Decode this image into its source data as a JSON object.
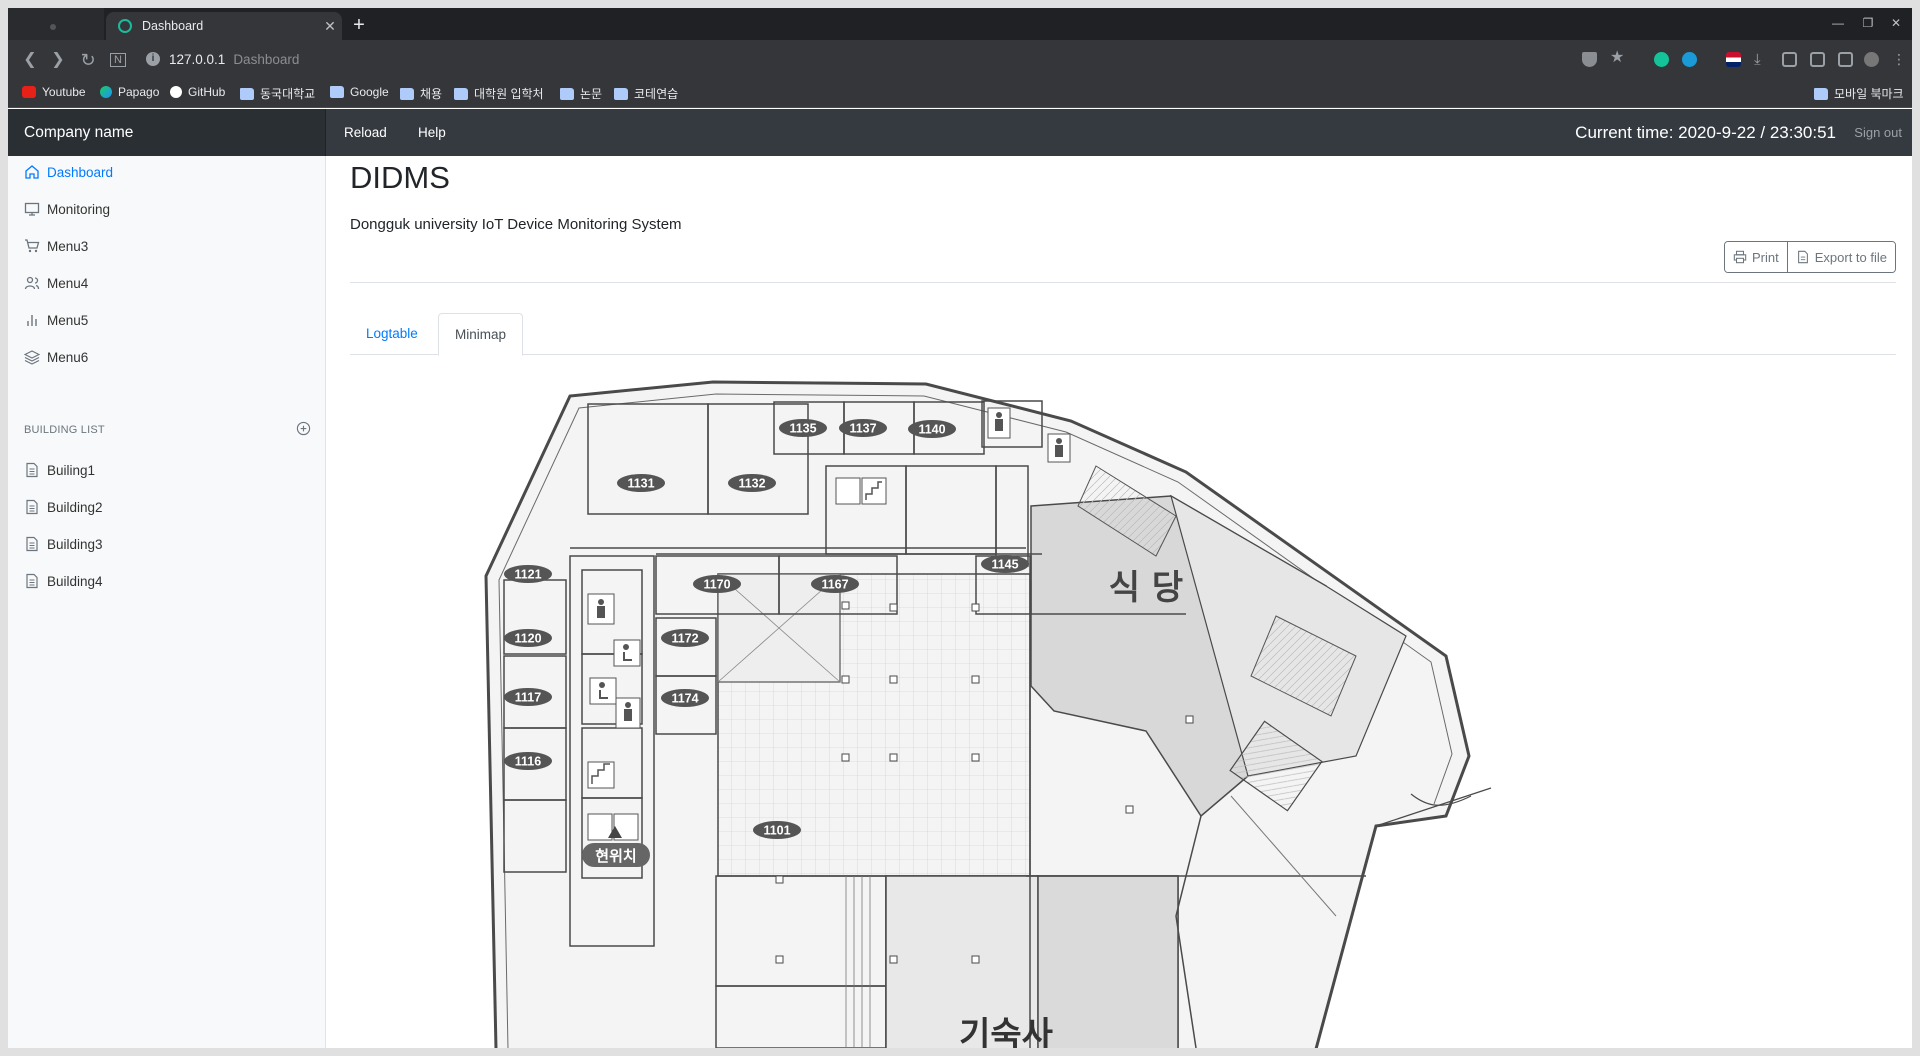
{
  "browser": {
    "tab_title": "Dashboard",
    "url_host": "127.0.0.1",
    "url_suffix": "Dashboard",
    "bookmarks": [
      {
        "label": "Youtube",
        "icon": "youtube-icon"
      },
      {
        "label": "Papago",
        "icon": "papago-icon"
      },
      {
        "label": "GitHub",
        "icon": "github-icon"
      },
      {
        "label": "동국대학교",
        "icon": "folder-icon"
      },
      {
        "label": "Google",
        "icon": "folder-icon"
      },
      {
        "label": "채용",
        "icon": "folder-icon"
      },
      {
        "label": "대학원 입학처",
        "icon": "folder-icon"
      },
      {
        "label": "논문",
        "icon": "folder-icon"
      },
      {
        "label": "코테연습",
        "icon": "folder-icon"
      }
    ],
    "mobile_bookmarks": "모바일 북마크"
  },
  "navbar": {
    "brand": "Company name",
    "links": [
      "Reload",
      "Help"
    ],
    "clock": "Current time: 2020-9-22 / 23:30:51",
    "signout": "Sign out"
  },
  "sidebar": {
    "items": [
      {
        "label": "Dashboard",
        "icon": "home-icon",
        "active": true
      },
      {
        "label": "Monitoring",
        "icon": "monitor-icon"
      },
      {
        "label": "Menu3",
        "icon": "cart-icon"
      },
      {
        "label": "Menu4",
        "icon": "users-icon"
      },
      {
        "label": "Menu5",
        "icon": "bar-chart-icon"
      },
      {
        "label": "Menu6",
        "icon": "layers-icon"
      }
    ],
    "section_heading": "BUILDING LIST",
    "buildings": [
      "Builing1",
      "Building2",
      "Building3",
      "Building4"
    ]
  },
  "main": {
    "title": "DIDMS",
    "subtitle": "Dongguk university IoT Device Monitoring System",
    "print_label": "Print",
    "export_label": "Export to file",
    "tabs": [
      {
        "label": "Logtable",
        "active": false
      },
      {
        "label": "Minimap",
        "active": true
      }
    ]
  },
  "minimap": {
    "rooms": [
      "1135",
      "1137",
      "1140",
      "1131",
      "1132",
      "1145",
      "1121",
      "1170",
      "1167",
      "1120",
      "1172",
      "1117",
      "1174",
      "1116",
      "1101"
    ],
    "labels": {
      "cafeteria": "식 당",
      "current_location": "현위치",
      "dormitory": "기숙사"
    },
    "colors": {
      "line": "#4a4a4a",
      "fill_gray": "#d8d8d8",
      "badge": "#555555"
    }
  }
}
